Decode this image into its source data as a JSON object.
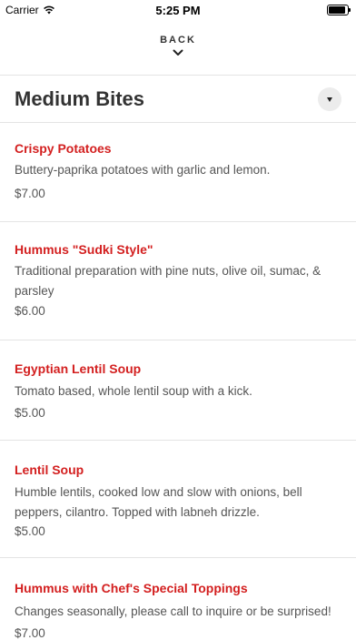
{
  "status_bar": {
    "carrier": "Carrier",
    "time": "5:25 PM",
    "battery_level": 1.0
  },
  "nav": {
    "back_label": "BACK"
  },
  "section": {
    "title": "Medium Bites"
  },
  "items": [
    {
      "name": "Crispy Potatoes",
      "description": "Buttery-paprika potatoes with garlic and lemon.",
      "price": "$7.00"
    },
    {
      "name": "Hummus \"Sudki Style\"",
      "description": "Traditional preparation with pine nuts, olive oil, sumac, & parsley",
      "price": "$6.00"
    },
    {
      "name": "Egyptian Lentil Soup",
      "description": "Tomato based, whole lentil soup with a kick.",
      "price": "$5.00"
    },
    {
      "name": "Lentil Soup",
      "description": "Humble lentils, cooked low and slow with onions, bell peppers, cilantro. Topped with labneh drizzle.",
      "price": "$5.00"
    },
    {
      "name": "Hummus with Chef's Special Toppings",
      "description": "Changes seasonally, please call to inquire or be surprised!",
      "price": "$7.00"
    }
  ]
}
